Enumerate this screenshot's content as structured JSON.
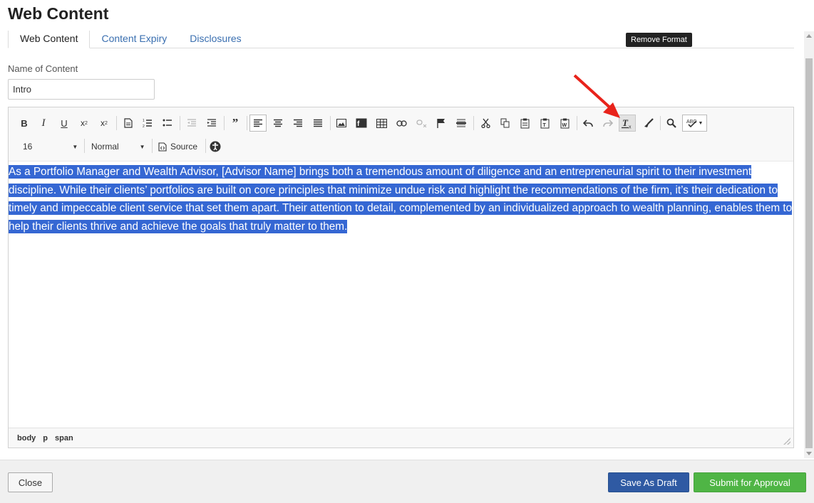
{
  "title": "Web Content",
  "tabs": [
    "Web Content",
    "Content Expiry",
    "Disclosures"
  ],
  "field": {
    "label": "Name of Content",
    "value": "Intro"
  },
  "toolbar": {
    "font_size": "16",
    "paragraph_format": "Normal",
    "source_label": "Source",
    "tooltip": "Remove Format"
  },
  "content": {
    "text": "As a Portfolio Manager and Wealth Advisor, [Advisor Name] brings both a tremendous amount of diligence and an entrepreneurial spirit to their investment discipline. While their clients’ portfolios are built on core principles that minimize undue risk and highlight the recommendations of the firm, it’s their dedication to timely and impeccable client service that set them apart.  Their attention to detail, complemented by an individualized approach to wealth planning, enables them to help their clients thrive and achieve the goals that truly matter to them."
  },
  "statusbar": {
    "path": [
      "body",
      "p",
      "span"
    ]
  },
  "buttons": {
    "close": "Close",
    "draft": "Save As Draft",
    "submit": "Submit for Approval"
  },
  "colors": {
    "selection": "#3567d3",
    "draft": "#2f5aa3",
    "submit": "#4fb545",
    "annotation_arrow": "#e8231b"
  }
}
